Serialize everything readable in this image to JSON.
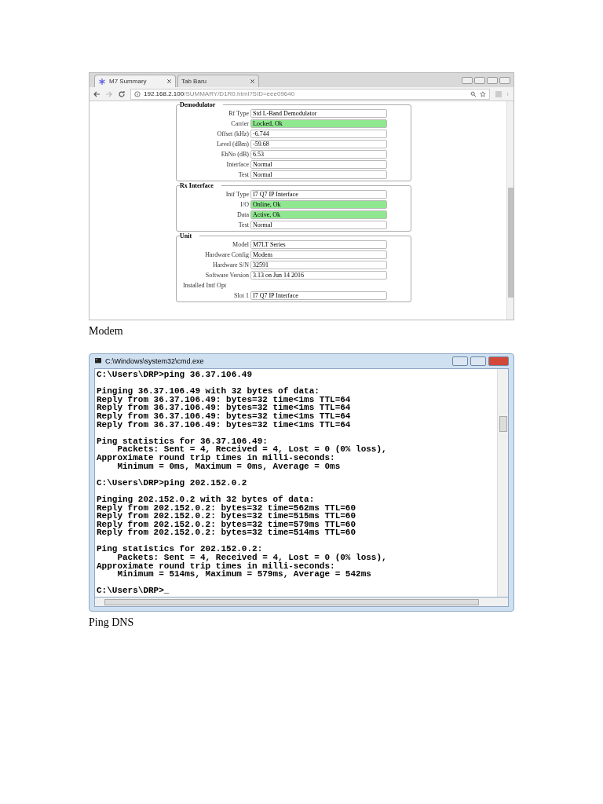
{
  "browser": {
    "tabs": [
      {
        "label": "M7 Summary",
        "selected": true
      },
      {
        "label": "Tab Baru",
        "selected": false
      }
    ],
    "address": {
      "host": "192.168.2.100",
      "path": "/SUMMARY/D1R0.html?SID=eee09640"
    },
    "sections": [
      {
        "title": "Demodulator",
        "fields": [
          {
            "label": "Rf Type",
            "value": "Std L-Band Demodulator",
            "ok": false
          },
          {
            "label": "Carrier",
            "value": "Locked, Ok",
            "ok": true
          },
          {
            "label": "Offset (kHz)",
            "value": "-6.744",
            "ok": false
          },
          {
            "label": "Level (dBm)",
            "value": "-59.68",
            "ok": false
          },
          {
            "label": "EbNo (dB)",
            "value": "6.53",
            "ok": false
          },
          {
            "label": "Interface",
            "value": "Normal",
            "ok": false
          },
          {
            "label": "Test",
            "value": "Normal",
            "ok": false
          }
        ]
      },
      {
        "title": "Rx Interface",
        "fields": [
          {
            "label": "Intf Type",
            "value": "I7 Q7 IP Interface",
            "ok": false
          },
          {
            "label": "I/O",
            "value": "Online, Ok",
            "ok": true
          },
          {
            "label": "Data",
            "value": "Active, Ok",
            "ok": true
          },
          {
            "label": "Test",
            "value": "Normal",
            "ok": false
          }
        ]
      },
      {
        "title": "Unit",
        "fields": [
          {
            "label": "Model",
            "value": "M7LT Series",
            "ok": false
          },
          {
            "label": "Hardware Config",
            "value": "Modem",
            "ok": false
          },
          {
            "label": "Hardware S/N",
            "value": "32591",
            "ok": false
          },
          {
            "label": "Software Version",
            "value": "3.13 on Jun 14 2016",
            "ok": false
          },
          {
            "label": "Installed Intf Opt",
            "kind": "heading"
          },
          {
            "label": "Slot 1",
            "value": "I7 Q7 IP Interface",
            "ok": false
          }
        ]
      }
    ]
  },
  "caption_1": "Modem",
  "console": {
    "title": "C:\\Windows\\system32\\cmd.exe",
    "blocks": [
      [
        "C:\\Users\\DRP>ping 36.37.106.49"
      ],
      [
        "Pinging 36.37.106.49 with 32 bytes of data:",
        "Reply from 36.37.106.49: bytes=32 time<1ms TTL=64",
        "Reply from 36.37.106.49: bytes=32 time<1ms TTL=64",
        "Reply from 36.37.106.49: bytes=32 time<1ms TTL=64",
        "Reply from 36.37.106.49: bytes=32 time<1ms TTL=64"
      ],
      [
        "Ping statistics for 36.37.106.49:",
        "    Packets: Sent = 4, Received = 4, Lost = 0 (0% loss),",
        "Approximate round trip times in milli-seconds:",
        "    Minimum = 0ms, Maximum = 0ms, Average = 0ms"
      ],
      [
        "C:\\Users\\DRP>ping 202.152.0.2"
      ],
      [
        "Pinging 202.152.0.2 with 32 bytes of data:",
        "Reply from 202.152.0.2: bytes=32 time=562ms TTL=60",
        "Reply from 202.152.0.2: bytes=32 time=515ms TTL=60",
        "Reply from 202.152.0.2: bytes=32 time=579ms TTL=60",
        "Reply from 202.152.0.2: bytes=32 time=514ms TTL=60"
      ],
      [
        "Ping statistics for 202.152.0.2:",
        "    Packets: Sent = 4, Received = 4, Lost = 0 (0% loss),",
        "Approximate round trip times in milli-seconds:",
        "    Minimum = 514ms, Maximum = 579ms, Average = 542ms"
      ],
      [
        "C:\\Users\\DRP>_"
      ]
    ]
  },
  "caption_2": "Ping DNS"
}
